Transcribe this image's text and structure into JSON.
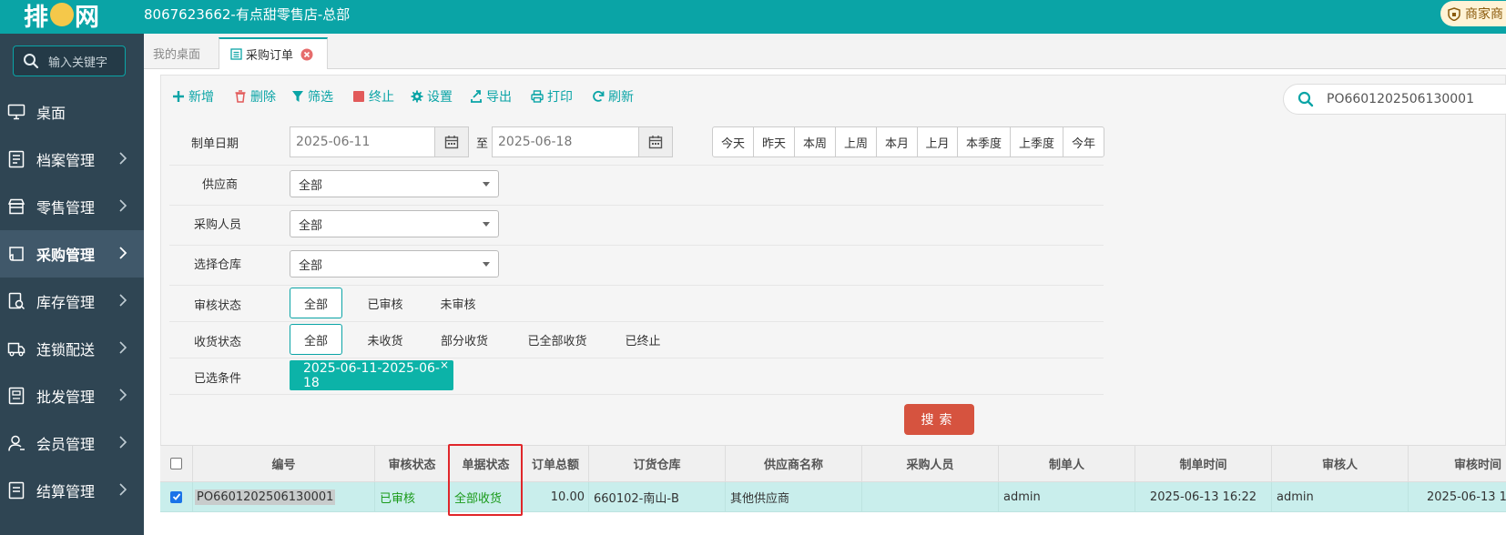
{
  "header": {
    "logo_text_1": "排",
    "logo_text_2": "网",
    "shop_title": "8067623662-有点甜零售店-总部",
    "merchant_label": "商家商"
  },
  "sidebar": {
    "search_placeholder": "输入关键字",
    "items": [
      {
        "label": "桌面",
        "icon": "desktop-icon",
        "chevron": false
      },
      {
        "label": "档案管理",
        "icon": "archive-icon",
        "chevron": true
      },
      {
        "label": "零售管理",
        "icon": "store-icon",
        "chevron": true
      },
      {
        "label": "采购管理",
        "icon": "purchase-icon",
        "chevron": true,
        "active": true
      },
      {
        "label": "库存管理",
        "icon": "inventory-icon",
        "chevron": true
      },
      {
        "label": "连锁配送",
        "icon": "truck-icon",
        "chevron": true
      },
      {
        "label": "批发管理",
        "icon": "wholesale-icon",
        "chevron": true
      },
      {
        "label": "会员管理",
        "icon": "member-icon",
        "chevron": true
      },
      {
        "label": "结算管理",
        "icon": "settlement-icon",
        "chevron": true
      }
    ]
  },
  "tabs": {
    "home": "我的桌面",
    "active": "采购订单"
  },
  "toolbar": {
    "add": "新增",
    "delete": "删除",
    "filter": "筛选",
    "stop": "终止",
    "settings": "设置",
    "export": "导出",
    "print": "打印",
    "refresh": "刷新",
    "search_value": "PO6601202506130001"
  },
  "filters": {
    "date_label": "制单日期",
    "date_from": "2025-06-11",
    "date_to_sep": "至",
    "date_to": "2025-06-18",
    "quick_ranges": [
      "今天",
      "昨天",
      "本周",
      "上周",
      "本月",
      "上月",
      "本季度",
      "上季度",
      "今年"
    ],
    "supplier_label": "供应商",
    "supplier_value": "全部",
    "buyer_label": "采购人员",
    "buyer_value": "全部",
    "warehouse_label": "选择仓库",
    "warehouse_value": "全部",
    "audit_label": "审核状态",
    "audit_options": [
      "全部",
      "已审核",
      "未审核"
    ],
    "receive_label": "收货状态",
    "receive_options": [
      "全部",
      "未收货",
      "部分收货",
      "已全部收货",
      "已终止"
    ],
    "selected_label": "已选条件",
    "selected_chip": "2025-06-11-2025-06-18",
    "chip_close": "×",
    "search_button": "搜索"
  },
  "table": {
    "headers": [
      "编号",
      "审核状态",
      "单据状态",
      "订单总额",
      "订货仓库",
      "供应商名称",
      "采购人员",
      "制单人",
      "制单时间",
      "审核人",
      "审核时间"
    ],
    "rows": [
      {
        "id": "PO6601202506130001",
        "audit_status": "已审核",
        "doc_status": "全部收货",
        "total": "10.00",
        "warehouse": "660102-南山-B",
        "supplier": "其他供应商",
        "buyer": "",
        "creator": "admin",
        "created_at": "2025-06-13 16:22",
        "auditor": "admin",
        "audited_at": "2025-06-13 1"
      }
    ]
  }
}
